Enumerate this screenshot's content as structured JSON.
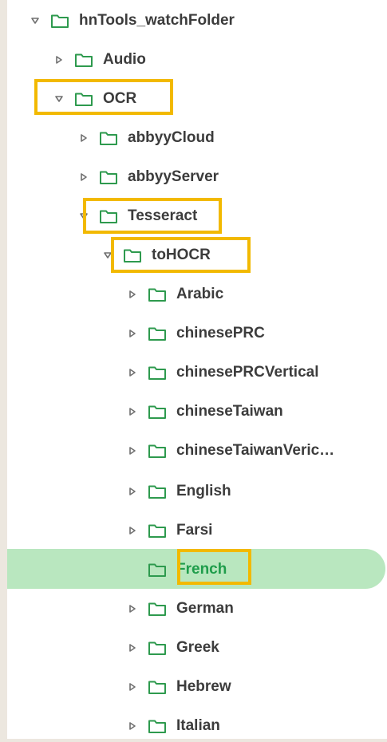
{
  "tree": {
    "items": [
      {
        "label": "hnTools_watchFolder",
        "expanded": true
      },
      {
        "label": "Audio",
        "expanded": false
      },
      {
        "label": "OCR",
        "expanded": true
      },
      {
        "label": "abbyyCloud",
        "expanded": false
      },
      {
        "label": "abbyyServer",
        "expanded": false
      },
      {
        "label": "Tesseract",
        "expanded": true
      },
      {
        "label": "toHOCR",
        "expanded": true
      },
      {
        "label": "Arabic",
        "expanded": false
      },
      {
        "label": "chinesePRC",
        "expanded": false
      },
      {
        "label": "chinesePRCVertical",
        "expanded": false
      },
      {
        "label": "chineseTaiwan",
        "expanded": false
      },
      {
        "label": "chineseTaiwanVeric…",
        "expanded": false
      },
      {
        "label": "English",
        "expanded": false
      },
      {
        "label": "Farsi",
        "expanded": false
      },
      {
        "label": "French",
        "expanded": false,
        "selected": true
      },
      {
        "label": "German",
        "expanded": false
      },
      {
        "label": "Greek",
        "expanded": false
      },
      {
        "label": "Hebrew",
        "expanded": false
      },
      {
        "label": "Italian",
        "expanded": false
      }
    ]
  },
  "colors": {
    "folder_outline": "#2e9a4e",
    "highlight_box": "#f2b900",
    "selected_background": "#b9e7bf",
    "selected_text": "#1f9d4b"
  }
}
